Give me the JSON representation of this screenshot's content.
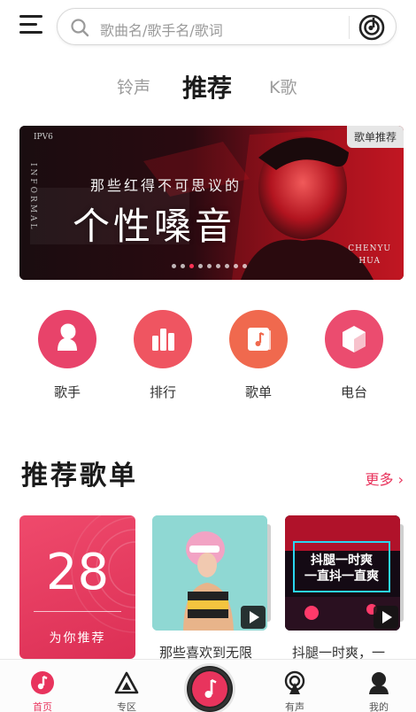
{
  "search": {
    "placeholder": "歌曲名/歌手名/歌词",
    "menu_icon": "menu-icon",
    "search_icon": "search-icon",
    "recognize_icon": "music-recognize-icon"
  },
  "tabs": [
    {
      "label": "铃声",
      "active": false
    },
    {
      "label": "推荐",
      "active": true
    },
    {
      "label": "K歌",
      "active": false
    }
  ],
  "banner": {
    "tag": "歌单推荐",
    "logo_text": "IPV6",
    "vertical_text": "INFORMAL",
    "subtitle": "那些红得不可思议的",
    "title": "个性嗓音",
    "artist_line1": "CHENYU",
    "artist_line2": "HUA",
    "dot_count": 9,
    "active_dot": 2
  },
  "categories": [
    {
      "label": "歌手",
      "icon": "singer-icon",
      "color": "#e8436a"
    },
    {
      "label": "排行",
      "icon": "chart-icon",
      "color": "#ef5561"
    },
    {
      "label": "歌单",
      "icon": "playlist-icon",
      "color": "#f0694e"
    },
    {
      "label": "电台",
      "icon": "radio-icon",
      "color": "#eb4c6f"
    }
  ],
  "section": {
    "title": "推荐歌单",
    "more": "更多"
  },
  "daily": {
    "day": "28",
    "label": "为你推荐"
  },
  "playlists": [
    {
      "title": "那些喜欢到无限",
      "has_play": true
    },
    {
      "title": "抖腿一时爽，一",
      "has_play": true
    }
  ],
  "playlist2_art_text": {
    "line1": "抖腿一时爽",
    "line2": "一直抖一直爽"
  },
  "bottom_nav": [
    {
      "label": "首页",
      "icon": "home-icon",
      "active": true
    },
    {
      "label": "专区",
      "icon": "zone-icon",
      "active": false
    },
    {
      "label": "",
      "icon": "music-center-icon",
      "active": false
    },
    {
      "label": "有声",
      "icon": "audio-icon",
      "active": false
    },
    {
      "label": "我的",
      "icon": "profile-icon",
      "active": false
    }
  ],
  "colors": {
    "accent": "#e8345d",
    "text_primary": "#1a1a1a",
    "text_muted": "#9c9c9c"
  }
}
